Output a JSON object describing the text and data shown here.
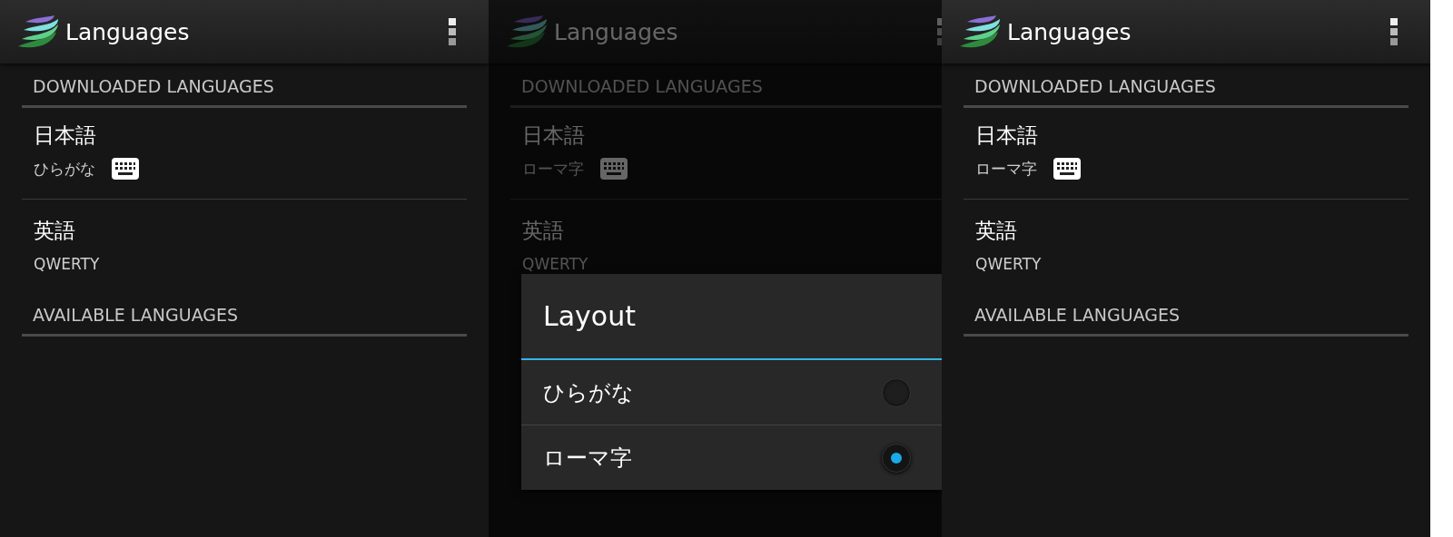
{
  "screens": [
    {
      "title": "Languages",
      "sections": [
        {
          "header": "DOWNLOADED LANGUAGES",
          "items": [
            {
              "name": "日本語",
              "layout": "ひらがな",
              "keyboard": true
            },
            {
              "name": "英語",
              "layout": "QWERTY"
            }
          ]
        },
        {
          "header": "AVAILABLE LANGUAGES"
        }
      ]
    },
    {
      "title": "Languages",
      "sections": [
        {
          "header": "DOWNLOADED LANGUAGES",
          "items": [
            {
              "name": "日本語",
              "layout": "ローマ字",
              "keyboard": true
            },
            {
              "name": "英語",
              "layout": "QWERTY"
            }
          ]
        }
      ],
      "dialog": {
        "title": "Layout",
        "options": [
          {
            "label": "ひらがな",
            "selected": false
          },
          {
            "label": "ローマ字",
            "selected": true
          }
        ]
      }
    },
    {
      "title": "Languages",
      "sections": [
        {
          "header": "DOWNLOADED LANGUAGES",
          "items": [
            {
              "name": "日本語",
              "layout": "ローマ字",
              "keyboard": true
            },
            {
              "name": "英語",
              "layout": "QWERTY"
            }
          ]
        },
        {
          "header": "AVAILABLE LANGUAGES"
        }
      ]
    }
  ]
}
